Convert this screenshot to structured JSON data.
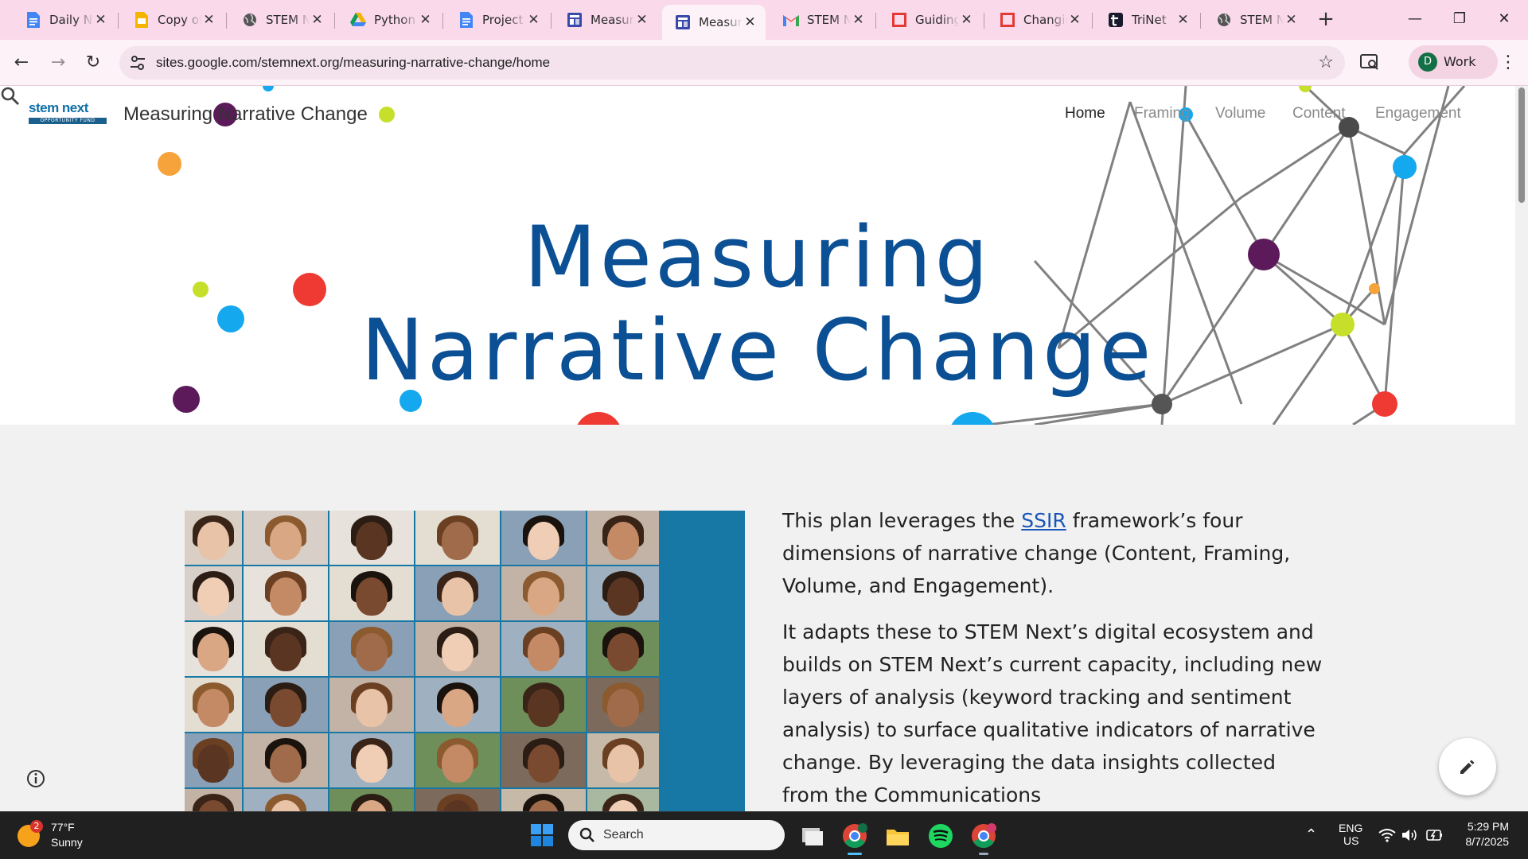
{
  "browser": {
    "tabs": [
      {
        "title": "Daily Notes",
        "icon": "google-docs-icon",
        "active": false
      },
      {
        "title": "Copy of",
        "icon": "google-slides-icon",
        "active": false
      },
      {
        "title": "STEM Next",
        "icon": "globe-icon",
        "active": false
      },
      {
        "title": "Python",
        "icon": "google-drive-icon",
        "active": false
      },
      {
        "title": "Project",
        "icon": "google-docs-icon",
        "active": false
      },
      {
        "title": "Measuring",
        "icon": "google-sites-icon",
        "active": false
      },
      {
        "title": "Measuring",
        "icon": "google-sites-icon",
        "active": true
      },
      {
        "title": "STEM Next",
        "icon": "gmail-icon",
        "active": false
      },
      {
        "title": "Guiding",
        "icon": "red-square-icon",
        "active": false
      },
      {
        "title": "Changing",
        "icon": "red-square-icon",
        "active": false
      },
      {
        "title": "TriNet",
        "icon": "trinet-icon",
        "active": false
      },
      {
        "title": "STEM Next",
        "icon": "globe-icon",
        "active": false
      }
    ],
    "url": "sites.google.com/stemnext.org/measuring-narrative-change/home",
    "profile_initial": "D",
    "profile_label": "Work"
  },
  "site": {
    "logo_text": "stem next",
    "logo_subtext": "OPPORTUNITY FUND",
    "title": "Measuring Narrative Change",
    "nav": [
      {
        "label": "Home",
        "current": true
      },
      {
        "label": "Framing",
        "current": false
      },
      {
        "label": "Volume",
        "current": false
      },
      {
        "label": "Content",
        "current": false
      },
      {
        "label": "Engagement",
        "current": false
      }
    ],
    "hero_line1": "Measuring",
    "hero_line2": "Narrative Change",
    "para1_before": "This plan leverages the ",
    "para1_link": "SSIR",
    "para1_after": " framework’s four dimensions of narrative change (Content, Framing, Volume, and Engagement).",
    "para2": "It adapts these to STEM Next’s digital ecosystem and builds on STEM Next’s current capacity, including new layers of analysis (keyword tracking and sentiment analysis) to surface qualitative indicators of narrative change. By leveraging the data insights collected from the Communications"
  },
  "taskbar": {
    "weather_temp": "77°F",
    "weather_cond": "Sunny",
    "weather_badge": "2",
    "search_label": "Search",
    "lang1": "ENG",
    "lang2": "US",
    "time": "5:29 PM",
    "date": "8/7/2025"
  },
  "colors": {
    "hero_title": "#0b4f94",
    "tabstrip": "#f9d9ea",
    "link": "#1a56b8"
  }
}
